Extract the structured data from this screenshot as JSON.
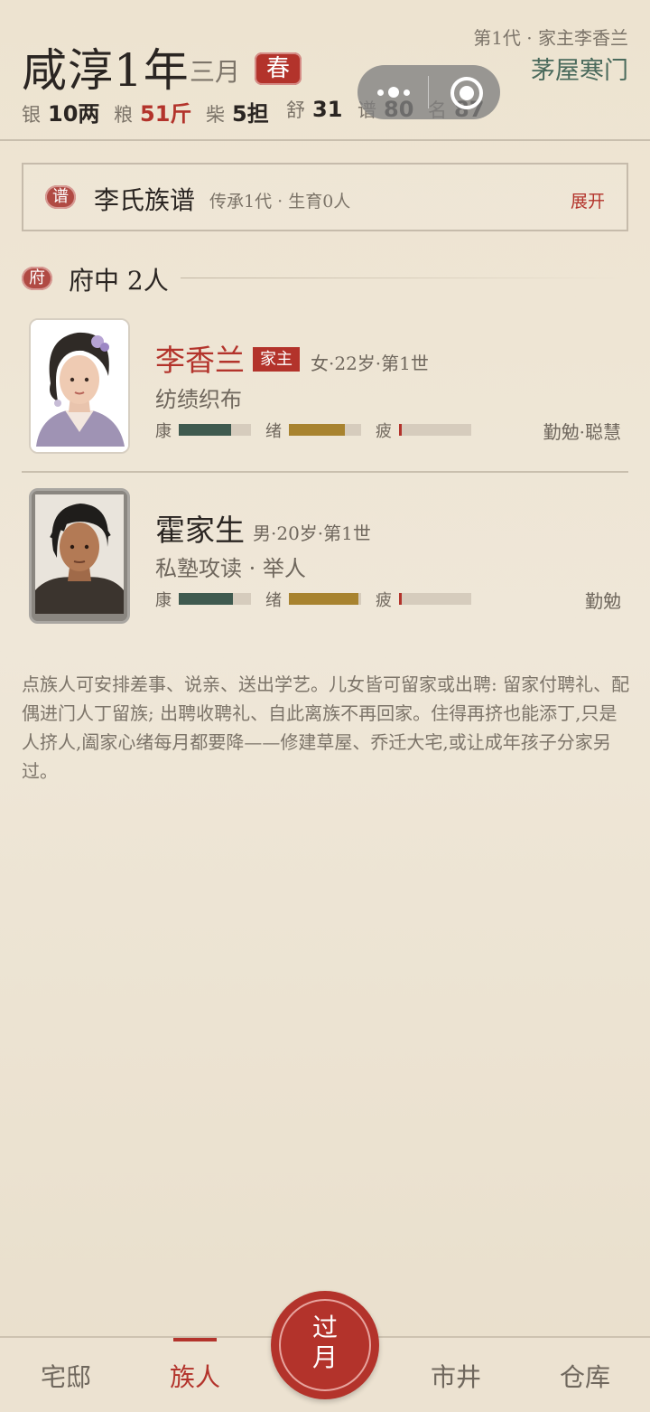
{
  "header": {
    "era": "咸淳1年",
    "month": "三月",
    "season": "春",
    "generation": "第1代 · 家主李香兰",
    "house_type": "茅屋寒门",
    "resources": [
      {
        "label": "银",
        "value": "10两",
        "color": "#2a2522"
      },
      {
        "label": "粮",
        "value": "51斤",
        "color": "#b3332b"
      },
      {
        "label": "柴",
        "value": "5担",
        "color": "#2a2522"
      },
      {
        "label": "舒",
        "value": "31",
        "color": "#2a2522"
      },
      {
        "label": "谱",
        "value": "80",
        "color": "#2a2522"
      },
      {
        "label": "名",
        "value": "87",
        "color": "#2a2522"
      }
    ]
  },
  "genealogy": {
    "badge": "谱",
    "title": "李氏族谱",
    "subtitle": "传承1代 · 生育0人",
    "expand_label": "展开"
  },
  "household": {
    "badge": "府",
    "title": "府中 2人",
    "members": [
      {
        "name": "李香兰",
        "tag": "家主",
        "meta": "女·22岁·第1世",
        "job": "纺绩织布",
        "stats": [
          {
            "label": "康",
            "level": 0.73,
            "color": "#3f5a4f"
          },
          {
            "label": "绪",
            "level": 0.77,
            "color": "#a8832f"
          },
          {
            "label": "疲",
            "level": 0.04,
            "color": "#b3332b"
          }
        ],
        "traits": "勤勉·聪慧"
      },
      {
        "name": "霍家生",
        "tag": "",
        "meta": "男·20岁·第1世",
        "job": "私塾攻读 · 举人",
        "stats": [
          {
            "label": "康",
            "level": 0.75,
            "color": "#3f5a4f"
          },
          {
            "label": "绪",
            "level": 0.96,
            "color": "#a8832f"
          },
          {
            "label": "疲",
            "level": 0.04,
            "color": "#b3332b"
          }
        ],
        "traits": "勤勉"
      }
    ]
  },
  "description": "点族人可安排差事、说亲、送出学艺。儿女皆可留家或出聘: 留家付聘礼、配偶进门人丁留族; 出聘收聘礼、自此离族不再回家。住得再挤也能添丁,只是人挤人,阖家心绪每月都要降——修建草屋、乔迁大宅,或让成年孩子分家另过。",
  "nav": {
    "items": [
      "宅邸",
      "族人",
      "市井",
      "仓库"
    ],
    "active": "族人",
    "next_month_line1": "过",
    "next_month_line2": "月"
  },
  "icons": {
    "capsule_more": "more-dots-icon",
    "capsule_close": "target-close-icon"
  }
}
